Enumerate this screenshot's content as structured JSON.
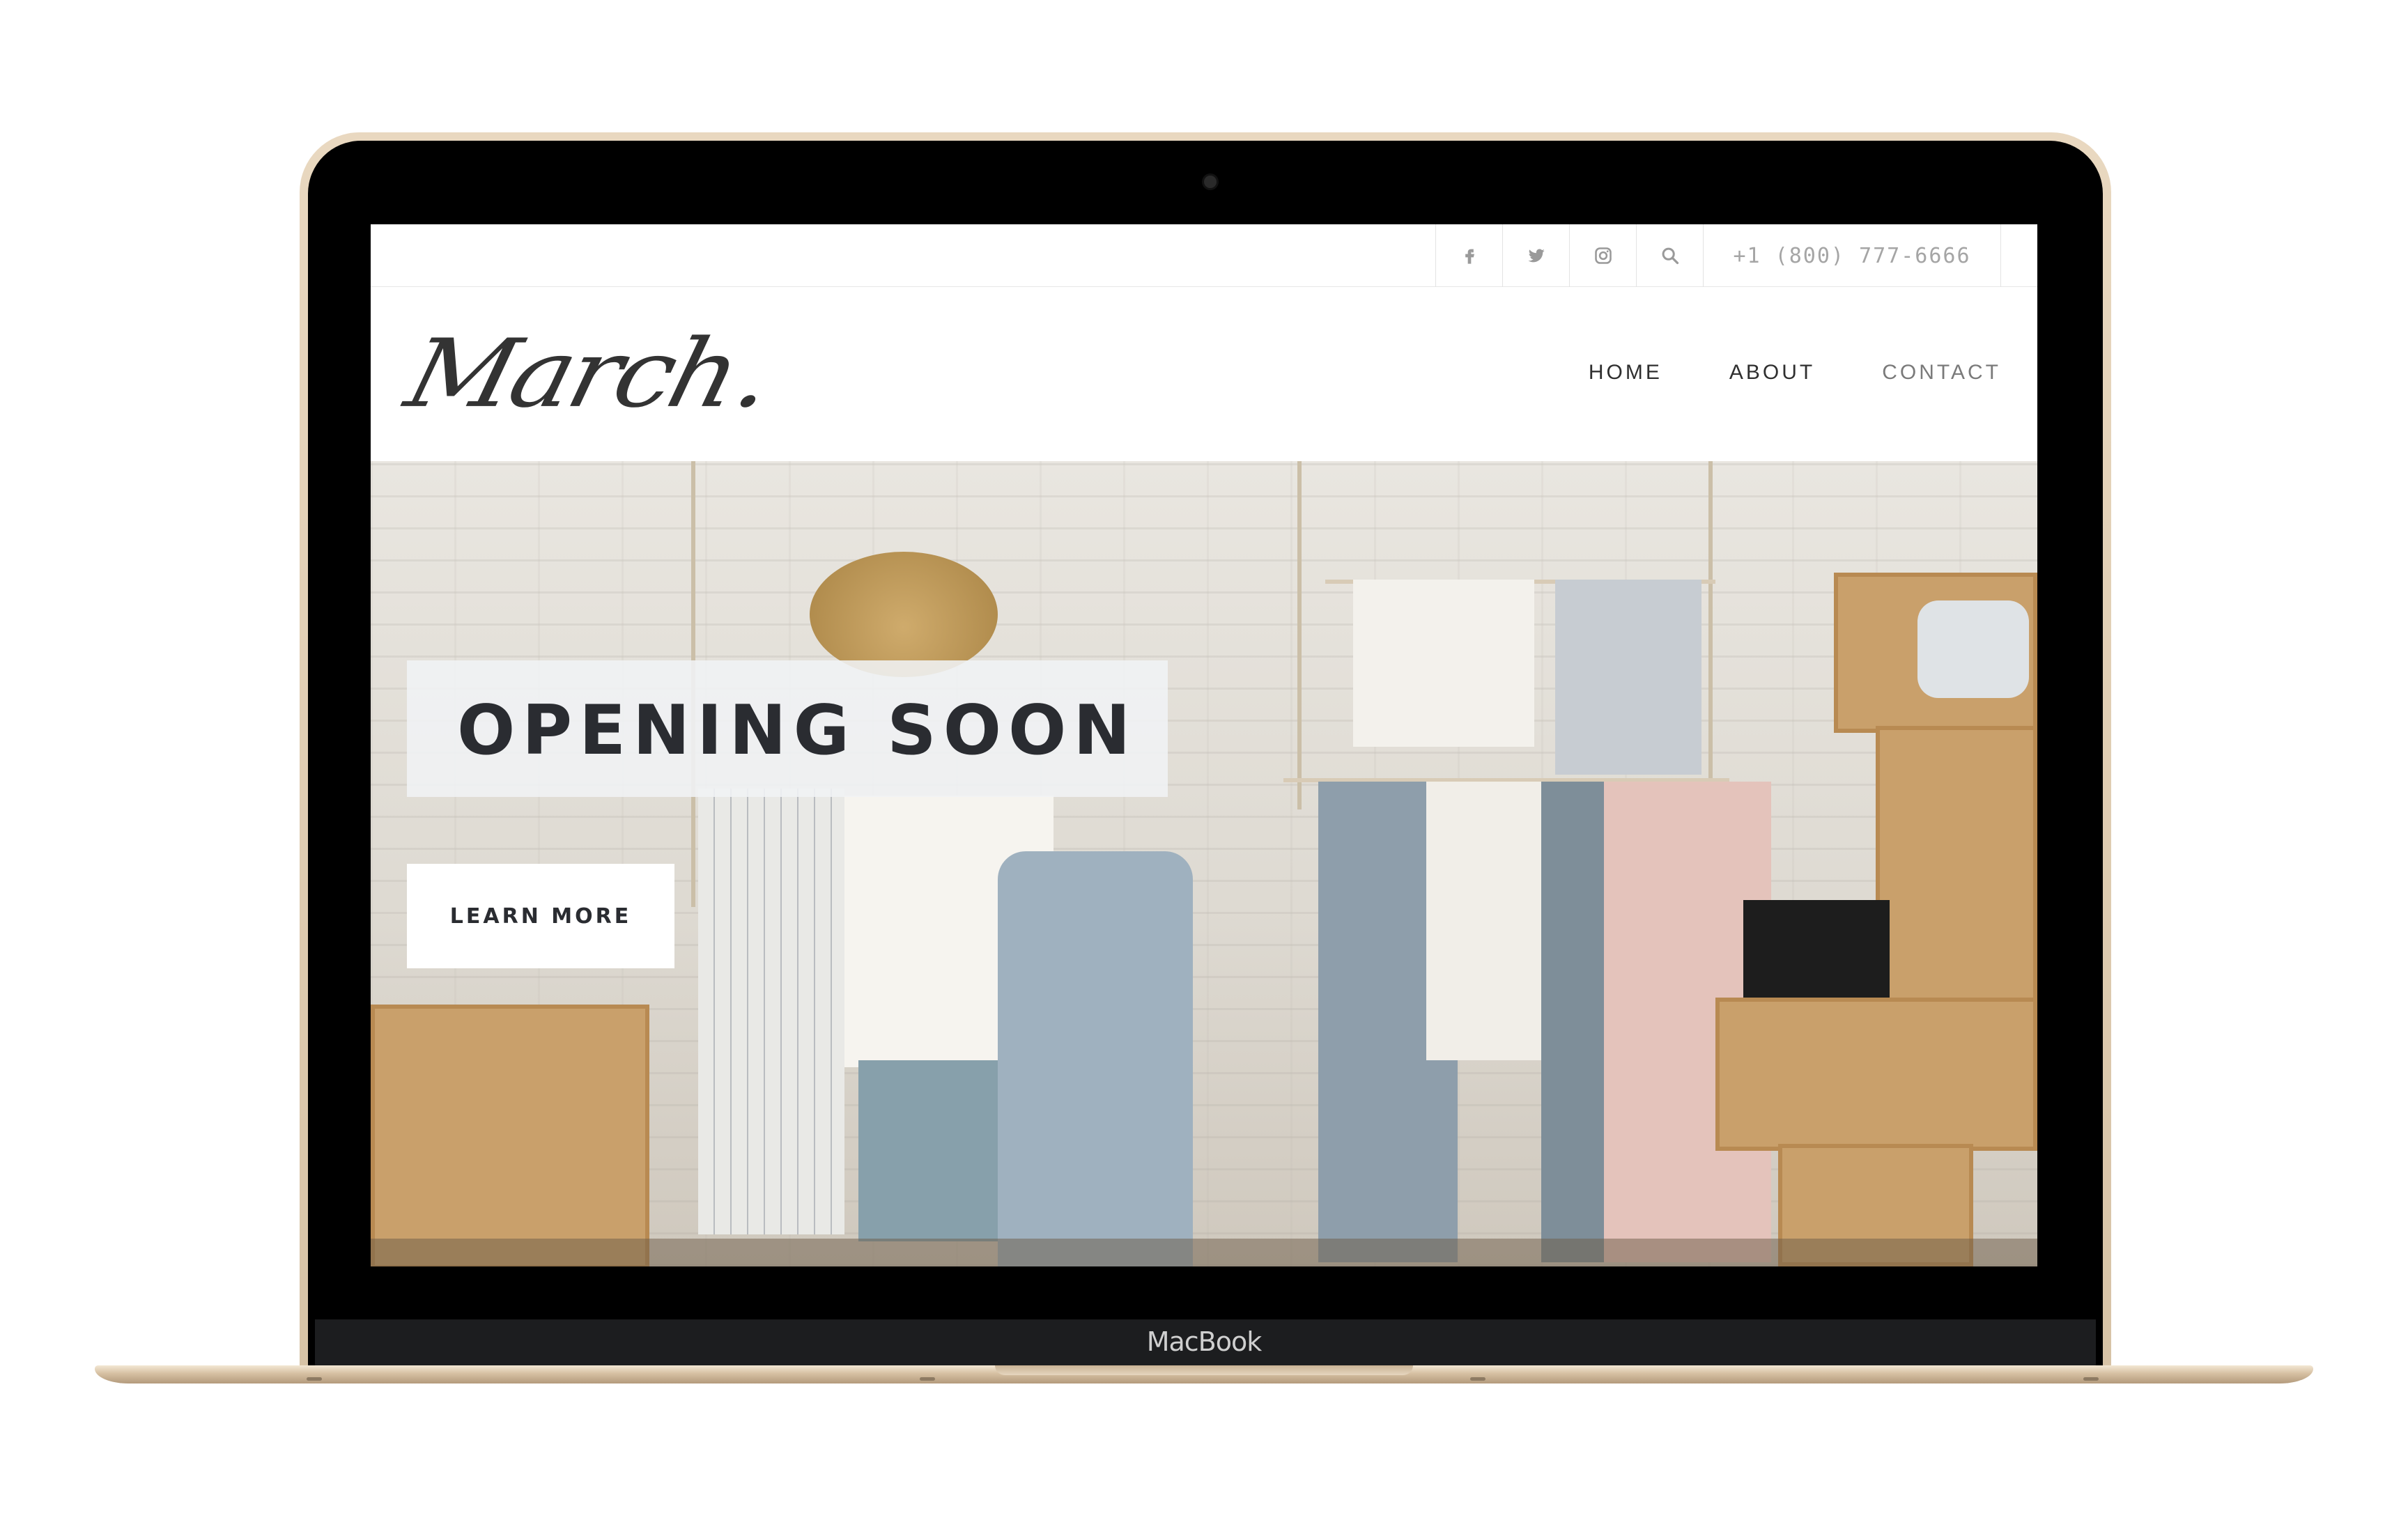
{
  "device": {
    "brand_label": "MacBook"
  },
  "topbar": {
    "icons": [
      "facebook-icon",
      "twitter-icon",
      "instagram-icon",
      "search-icon"
    ],
    "phone": "+1 (800) 777-6666"
  },
  "header": {
    "logo_text": "March",
    "logo_dot": ".",
    "nav": {
      "home": "HOME",
      "about": "ABOUT",
      "contact": "CONTACT"
    }
  },
  "hero": {
    "headline": "OPENING SOON",
    "cta_label": "LEARN MORE"
  },
  "colors": {
    "text_dark": "#2a2c31",
    "nav_muted": "#7a7a7a",
    "headline_box": "#f0f2f5",
    "laptop_gold": "#d7c3a6"
  }
}
